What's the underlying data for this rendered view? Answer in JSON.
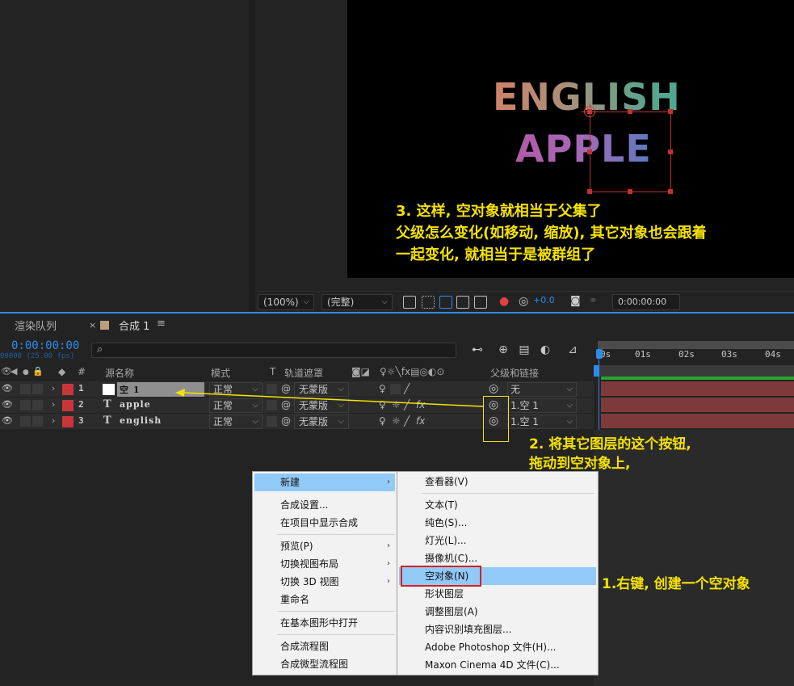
{
  "viewer": {
    "comp_text_1": "ENGLISH",
    "comp_text_2": "APPLE",
    "note_3_line1": "3. 这样, 空对象就相当于父集了",
    "note_3_line2": "父级怎么变化(如移动, 缩放), 其它对象也会跟着",
    "note_3_line3": "一起变化, 就相当于是被群组了"
  },
  "viewer_toolbar": {
    "zoom": "(100%)",
    "resolution": "(完整)",
    "exposure": "+0.0",
    "current_time": "0:00:00:00"
  },
  "tabs": {
    "render_queue": "渲染队列",
    "close": "×",
    "comp": "合成 1",
    "menu": "≡"
  },
  "timeline": {
    "timecode": "0:00:00:00",
    "fps": "00000 (25.00 fps)",
    "ruler_ticks": [
      "0s",
      "01s",
      "02s",
      "03s",
      "04s"
    ],
    "columns": {
      "num": "#",
      "source_name": "源名称",
      "mode": "模式",
      "t": "T",
      "track_matte": "轨道遮罩",
      "parent": "父级和链接"
    },
    "layers": [
      {
        "num": "1",
        "name": "空 1",
        "mode": "正常",
        "matte": "无蒙版",
        "parent": "无"
      },
      {
        "num": "2",
        "name": "apple",
        "mode": "正常",
        "matte": "无蒙版",
        "parent": "1.空 1"
      },
      {
        "num": "3",
        "name": "english",
        "mode": "正常",
        "matte": "无蒙版",
        "parent": "1.空 1"
      }
    ]
  },
  "annotations": {
    "note_2_line1": "2. 将其它图层的这个按钮,",
    "note_2_line2": "拖动到空对象上,",
    "note_1": "1.右键, 创建一个空对象"
  },
  "context_menu": {
    "items": [
      "新建",
      "合成设置...",
      "在项目中显示合成",
      "预览(P)",
      "切换视图布局",
      "切换 3D 视图",
      "重命名",
      "在基本图形中打开",
      "合成流程图",
      "合成微型流程图"
    ]
  },
  "submenu": {
    "items": [
      "查看器(V)",
      "文本(T)",
      "纯色(S)...",
      "灯光(L)...",
      "摄像机(C)...",
      "空对象(N)",
      "形状图层",
      "调整图层(A)",
      "内容识别填充图层...",
      "Adobe Photoshop 文件(H)...",
      "Maxon Cinema 4D 文件(C)..."
    ]
  },
  "colors": {
    "accent": "#2d8ceb",
    "annotation_yellow": "#f4e200",
    "layer_label_red": "#c8353a",
    "menu_highlight": "#91c9f7",
    "selection_red_box": "#d42020"
  }
}
